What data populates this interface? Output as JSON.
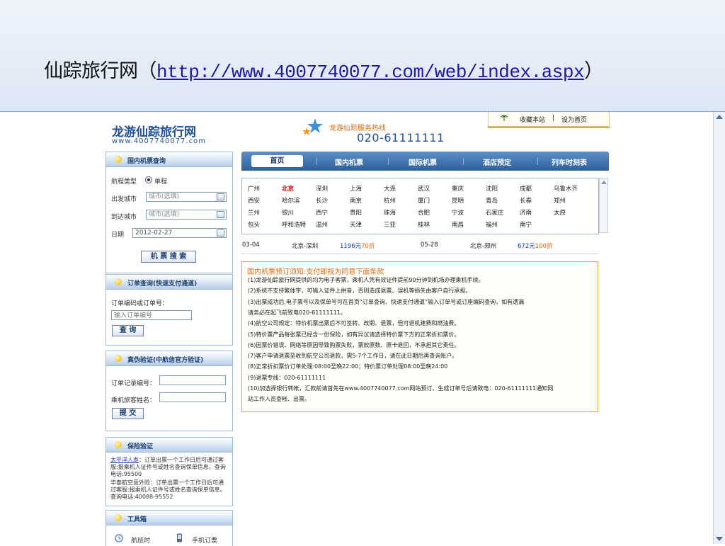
{
  "slide": {
    "title_prefix": "仙踪旅行网（",
    "title_link": "http://www.4007740077.com/web/index.aspx",
    "title_suffix": "）"
  },
  "site": {
    "logo_title": "龙游仙踪旅行网",
    "logo_url": "www.4007740077.com",
    "hotline_label": "龙游仙踪服务热线",
    "hotline_number": "020-61111111",
    "top_links": {
      "favorite": "收藏本站",
      "separator": "|",
      "homepage": "设为首页"
    }
  },
  "sidebar": {
    "domestic": {
      "title": "国内机票查询",
      "trip_type_label": "航程类型",
      "trip_type_value": "单程",
      "depart_label": "出发城市",
      "depart_value": "城市(选填)",
      "arrive_label": "到达城市",
      "arrive_value": "城市(选填)",
      "date_label": "日期",
      "date_value": "2012-02-27",
      "search_button": "机 票 搜 索"
    },
    "order": {
      "title": "订单查询(快速支付通道)",
      "label": "订单编码或订单号：",
      "placeholder": "输入订单编号",
      "button": "查 询"
    },
    "verify": {
      "title": "真伪验证(中航信官方验证)",
      "record_label": "订单记录编号：",
      "name_label": "乘机旅客姓名：",
      "button": "提 交"
    },
    "insurance": {
      "title": "保险验证",
      "items": [
        {
          "company": "太平洋人寿",
          "text": "：订单出票一个工作日后可通过客服:报乘机人证件号或姓名查询保单信息。查询电话:95500"
        },
        {
          "company": "华泰航空意外险",
          "text": "：订单出票一个工作日后可通过客服:报乘机人证件号或姓名查询保单信息。查询电话:40088-95552"
        }
      ]
    },
    "toolbox": {
      "title": "工具箱",
      "items": [
        "航班时",
        "手机订票"
      ]
    }
  },
  "nav": {
    "items": [
      "首页",
      "国内机票",
      "国际机票",
      "酒店预定",
      "列车时刻表"
    ]
  },
  "cities": [
    [
      "广州",
      "北京",
      "深圳",
      "上海",
      "大连",
      "武汉",
      "重庆",
      "沈阳",
      "成都",
      "乌鲁木齐"
    ],
    [
      "西安",
      "哈尔滨",
      "长沙",
      "南京",
      "杭州",
      "厦门",
      "昆明",
      "青岛",
      "长春",
      "郑州"
    ],
    [
      "兰州",
      "银川",
      "西宁",
      "贵阳",
      "珠海",
      "合肥",
      "宁波",
      "石家庄",
      "济南",
      "太原"
    ],
    [
      "包头",
      "呼和浩特",
      "温州",
      "天津",
      "三亚",
      "桂林",
      "南昌",
      "福州",
      "南宁"
    ]
  ],
  "active_city": "北京",
  "deals": [
    {
      "date": "03-04",
      "route": "北京-深圳",
      "price": "1196元",
      "discount": "70折"
    },
    {
      "date": "05-28",
      "route": "北京-郑州",
      "price": "672元",
      "discount": "100折"
    }
  ],
  "notice": {
    "title": "国内机票预订须知:支付即视为同意下面条款",
    "lines": [
      "(1)龙游仙踪旅行网提供的均为电子客票，乘机人凭有效证件提前90分钟到机场办理乘机手续。",
      "(2)系统不支持繁体字，可输入证件上拼音，否则造成退票、误机等损失由客户自行承担。",
      "(3)出票成功后,电子票号以及保单号可在首页“订单查询、快速支付通道”输入订单号或订座编码查询，如有遗漏",
      "请务必在起飞前致电020-61111111。",
      "(4)航空公司规定：特价机票出票后不可签转、改期、退票，但可退机建费和燃油费。",
      "(5)特价票产品每张票已经含一份保险，如有异议请选择特价票下方的正常折扣票价。",
      "(6)因票价错误、网络等原因导致购票失败，票款原数、原卡退回，不承担其它责任。",
      "(7)客户申请退票至收到航空公司退款，需5-7个工作日，请在此日期后再查询账户。",
      "(8)正常折扣票价订单处理:08:00至晚22:00；特价票订单处理08:00至晚24:00",
      "(9)退票专线：020-61111111",
      "(10)加选择银行转帐，汇款前请首先在www.4007740077.com网站预订、生成订单号后请致电：020-61111111通知网",
      "站工作人员查帐、出票。"
    ]
  },
  "colors": {
    "brand_blue": "#1f4f97",
    "accent_orange": "#e06a10",
    "nav_blue": "#2d5f9d",
    "active_red": "#dd0000"
  }
}
